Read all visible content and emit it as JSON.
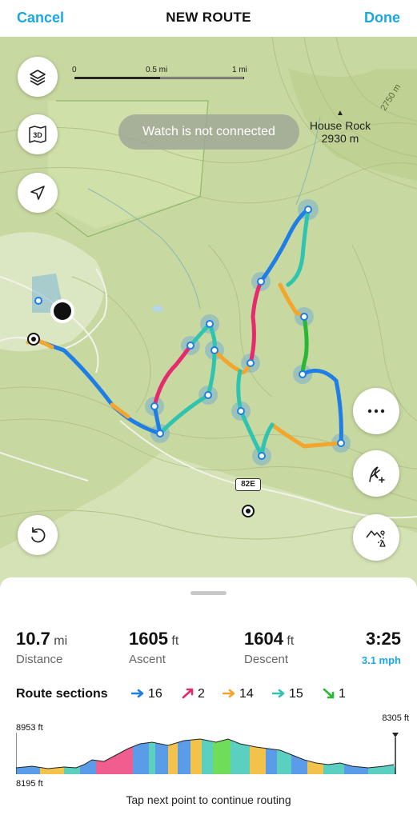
{
  "header": {
    "cancel_label": "Cancel",
    "title": "NEW ROUTE",
    "done_label": "Done"
  },
  "map": {
    "scale": {
      "start": "0",
      "mid": "0.5 mi",
      "end": "1 mi"
    },
    "banner": "Watch is not connected",
    "peak": {
      "name": "House Rock",
      "elevation": "2930 m"
    },
    "contour_label": "2750 m",
    "road_label": "82E",
    "buttons": {
      "layers": "layers-icon",
      "view3d": "3d-map-icon",
      "locate": "location-arrow-icon",
      "more": "more-icon",
      "add_point": "add-waypoint-icon",
      "undo": "undo-icon",
      "terrain": "terrain-routing-icon"
    }
  },
  "stats": {
    "distance": {
      "value": "10.7",
      "unit": "mi",
      "label": "Distance"
    },
    "ascent": {
      "value": "1605",
      "unit": "ft",
      "label": "Ascent"
    },
    "descent": {
      "value": "1604",
      "unit": "ft",
      "label": "Descent"
    },
    "duration": {
      "value": "3:25",
      "speed": "3.1 mph"
    }
  },
  "route_sections": {
    "title": "Route sections",
    "items": [
      {
        "count": "16",
        "color": "#1e7ee6",
        "icon": "arrow-right-icon"
      },
      {
        "count": "2",
        "color": "#e62a6e",
        "icon": "arrow-up-right-icon"
      },
      {
        "count": "14",
        "color": "#f3a62b",
        "icon": "arrow-right-icon"
      },
      {
        "count": "15",
        "color": "#2ec4b0",
        "icon": "arrow-right-icon"
      },
      {
        "count": "1",
        "color": "#27b834",
        "icon": "arrow-down-right-icon"
      }
    ]
  },
  "profile": {
    "max_label": "8953 ft",
    "min_label": "8195 ft",
    "end_label": "8305 ft"
  },
  "hint": "Tap next point to continue routing"
}
